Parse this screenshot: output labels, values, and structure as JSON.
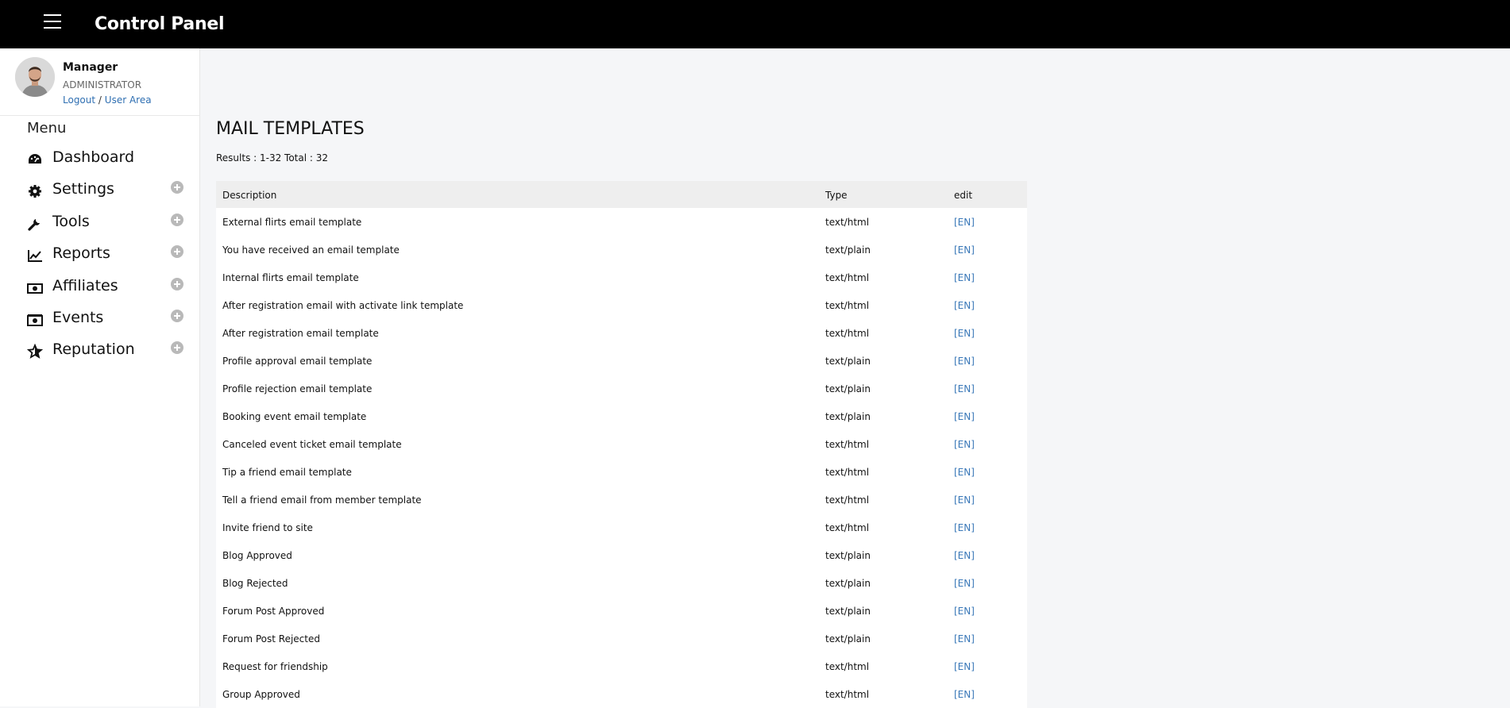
{
  "header": {
    "title": "Control Panel"
  },
  "user": {
    "name": "Manager",
    "role": "ADMINISTRATOR",
    "logout": "Logout",
    "separator": "/",
    "user_area": "User Area"
  },
  "sidebar": {
    "title": "Menu",
    "items": [
      {
        "label": "Dashboard",
        "icon": "dashboard-icon"
      },
      {
        "label": "Settings",
        "icon": "gear-icon"
      },
      {
        "label": "Tools",
        "icon": "wrench-icon"
      },
      {
        "label": "Reports",
        "icon": "chart-line-icon"
      },
      {
        "label": "Affiliates",
        "icon": "money-bill-icon"
      },
      {
        "label": "Events",
        "icon": "camera-icon"
      },
      {
        "label": "Reputation",
        "icon": "star-icon"
      }
    ]
  },
  "main": {
    "title": "MAIL TEMPLATES",
    "results": "Results : 1-32 Total : 32",
    "columns": [
      "Description",
      "Type",
      "edit"
    ],
    "rows": [
      {
        "description": "External flirts email template",
        "type": "text/html",
        "edit": "[EN]"
      },
      {
        "description": "You have received an email template",
        "type": "text/plain",
        "edit": "[EN]"
      },
      {
        "description": "Internal flirts email template",
        "type": "text/html",
        "edit": "[EN]"
      },
      {
        "description": "After registration email with activate link template",
        "type": "text/html",
        "edit": "[EN]"
      },
      {
        "description": "After registration email template",
        "type": "text/html",
        "edit": "[EN]"
      },
      {
        "description": "Profile approval email template",
        "type": "text/plain",
        "edit": "[EN]"
      },
      {
        "description": "Profile rejection email template",
        "type": "text/plain",
        "edit": "[EN]"
      },
      {
        "description": "Booking event email template",
        "type": "text/plain",
        "edit": "[EN]"
      },
      {
        "description": "Canceled event ticket email template",
        "type": "text/html",
        "edit": "[EN]"
      },
      {
        "description": "Tip a friend email template",
        "type": "text/html",
        "edit": "[EN]"
      },
      {
        "description": "Tell a friend email from member template",
        "type": "text/html",
        "edit": "[EN]"
      },
      {
        "description": "Invite friend to site",
        "type": "text/html",
        "edit": "[EN]"
      },
      {
        "description": "Blog Approved",
        "type": "text/plain",
        "edit": "[EN]"
      },
      {
        "description": "Blog Rejected",
        "type": "text/plain",
        "edit": "[EN]"
      },
      {
        "description": "Forum Post Approved",
        "type": "text/plain",
        "edit": "[EN]"
      },
      {
        "description": "Forum Post Rejected",
        "type": "text/plain",
        "edit": "[EN]"
      },
      {
        "description": "Request for friendship",
        "type": "text/html",
        "edit": "[EN]"
      },
      {
        "description": "Group Approved",
        "type": "text/html",
        "edit": "[EN]"
      }
    ]
  }
}
